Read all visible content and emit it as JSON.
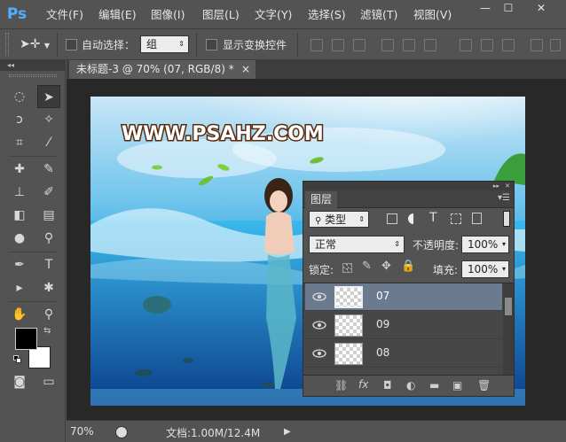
{
  "app": {
    "logo": "Ps"
  },
  "menu": [
    "文件(F)",
    "编辑(E)",
    "图像(I)",
    "图层(L)",
    "文字(Y)",
    "选择(S)",
    "滤镜(T)",
    "视图(V)"
  ],
  "window_controls": {
    "minimize": "—",
    "restore": "☐",
    "close": "✕"
  },
  "options_bar": {
    "auto_select_label": "自动选择：",
    "auto_select_value": "组",
    "show_transform_label": "显示变换控件"
  },
  "document": {
    "tab_title": "未标题-3 @ 70% (07, RGB/8) *",
    "tab_close": "×"
  },
  "image": {
    "watermark": "WWW.PSAHZ.COM"
  },
  "status": {
    "zoom": "70%",
    "doc_info": "文档:1.00M/12.4M"
  },
  "layers_panel": {
    "title": "图层",
    "filter_kind": "类型",
    "blend_mode": "正常",
    "opacity_label": "不透明度:",
    "opacity_value": "100%",
    "lock_label": "锁定:",
    "fill_label": "填充:",
    "fill_value": "100%",
    "layers": [
      {
        "name": "07",
        "selected": true
      },
      {
        "name": "09",
        "selected": false
      },
      {
        "name": "08",
        "selected": false
      }
    ],
    "footer_fx": "fx"
  },
  "colors": {
    "accent": "#4fb0ff",
    "selected_layer": "#6b7a8f",
    "panel_bg": "#535353"
  }
}
